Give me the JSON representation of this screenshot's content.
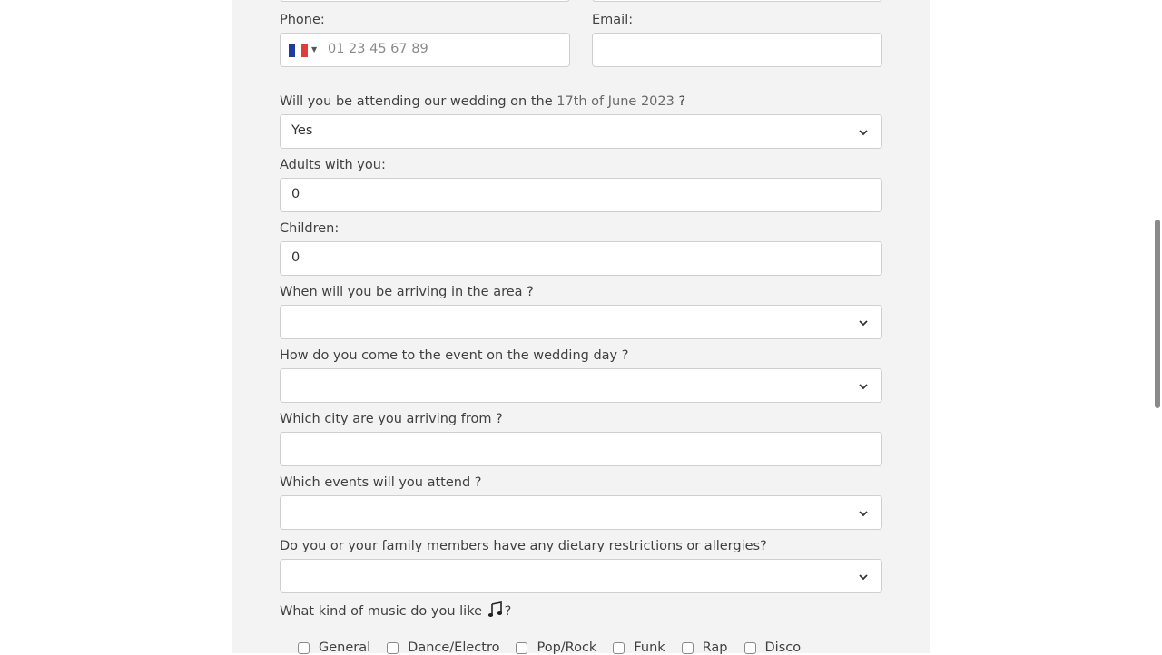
{
  "form": {
    "phone_label": "Phone:",
    "phone_placeholder": "01 23 45 67 89",
    "phone_country": "fr-flag-icon",
    "email_label": "Email:",
    "attending_label_pre": "Will you be attending our wedding on the",
    "attending_date": "17th of June 2023",
    "attending_label_post": "?",
    "attending_value": "Yes",
    "adults_label": "Adults with you:",
    "adults_value": "0",
    "children_label": "Children:",
    "children_value": "0",
    "arrival_label": "When will you be arriving in the area ?",
    "transport_label": "How do you come to the event on the wedding day ?",
    "city_label": "Which city are you arriving from ?",
    "events_label": "Which events will you attend ?",
    "dietary_label": "Do you or your family members have any dietary restrictions or allergies?",
    "music_label_pre": "What kind of music do you like",
    "music_label_post": "?",
    "music_icon": "music-note-icon",
    "music_options": [
      "General",
      "Dance/Electro",
      "Pop/Rock",
      "Funk",
      "Rap",
      "Disco"
    ]
  },
  "colors": {
    "panel_bg": "#f3f3f3",
    "field_border": "#cfcfcf",
    "scroll_thumb": "#8a8a8a"
  }
}
